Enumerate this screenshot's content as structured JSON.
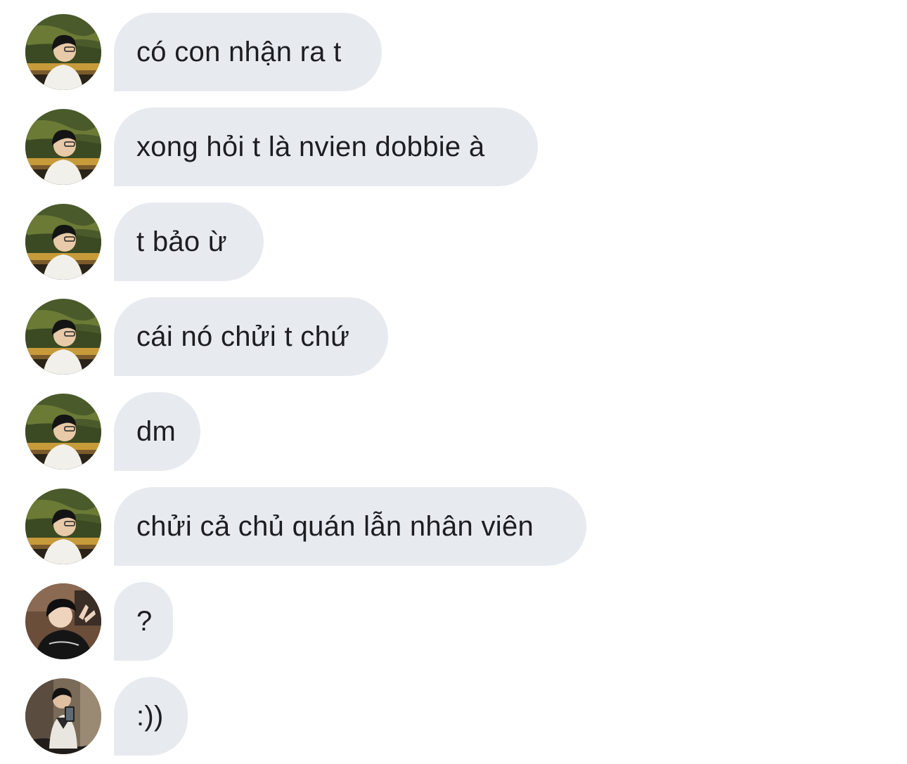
{
  "messages": [
    {
      "text": "có con nhận ra t",
      "sender": "user-a"
    },
    {
      "text": "xong hỏi t là nvien dobbie à",
      "sender": "user-a"
    },
    {
      "text": "t bảo ừ",
      "sender": "user-a"
    },
    {
      "text": "cái nó chửi t chứ",
      "sender": "user-a"
    },
    {
      "text": "dm",
      "sender": "user-a"
    },
    {
      "text": "chửi cả chủ quán lẫn nhân viên",
      "sender": "user-a"
    },
    {
      "text": "?",
      "sender": "user-b"
    },
    {
      "text": ":))",
      "sender": "user-c"
    }
  ],
  "colors": {
    "bubble_bg": "#e7ebf0",
    "text": "#1c1e21",
    "page_bg": "#ffffff"
  }
}
